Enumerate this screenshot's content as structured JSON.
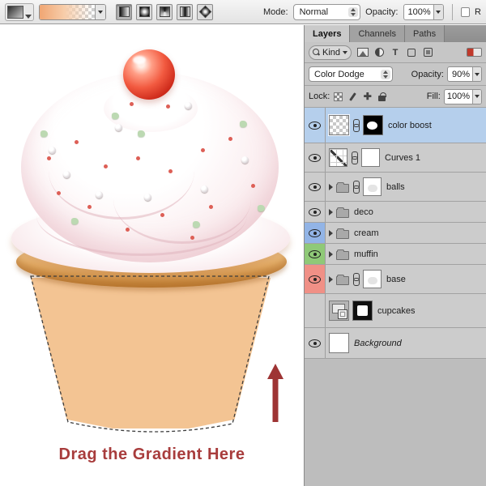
{
  "options_bar": {
    "mode_label": "Mode:",
    "mode_value": "Normal",
    "opacity_label": "Opacity:",
    "opacity_value": "100%",
    "reverse_label": "R",
    "gradient_types": [
      "linear",
      "radial",
      "angle",
      "reflected",
      "diamond"
    ]
  },
  "panel": {
    "tabs": [
      "Layers",
      "Channels",
      "Paths"
    ],
    "filter_kind_label": "Kind",
    "filter_icons": [
      "pixel-layer-filter",
      "adjustment-layer-filter",
      "type-layer-filter",
      "shape-layer-filter",
      "smart-object-filter"
    ],
    "blend_mode_value": "Color Dodge",
    "opacity_label": "Opacity:",
    "opacity_value": "90%",
    "lock_label": "Lock:",
    "lock_icons": [
      "lock-transparent-pixels",
      "lock-image-pixels",
      "lock-position",
      "lock-all"
    ],
    "fill_label": "Fill:",
    "fill_value": "100%",
    "layers": [
      {
        "name": "color boost",
        "kind": "pixel",
        "selected": true,
        "visible": true,
        "has_mask": true
      },
      {
        "name": "Curves 1",
        "kind": "adjustment",
        "visible": true,
        "has_mask": true
      },
      {
        "name": "balls",
        "kind": "group",
        "visible": true,
        "has_mask": true
      },
      {
        "name": "deco",
        "kind": "group",
        "visible": true
      },
      {
        "name": "cream",
        "kind": "group",
        "visible": true,
        "tag_color": "#92b4e6"
      },
      {
        "name": "muffin",
        "kind": "group",
        "visible": true,
        "tag_color": "#8fc977"
      },
      {
        "name": "base",
        "kind": "group",
        "visible": true,
        "has_mask": true,
        "tag_color": "#f09086"
      },
      {
        "name": "cupcakes",
        "kind": "smart-object",
        "visible": false,
        "has_mask": true
      },
      {
        "name": "Background",
        "kind": "background",
        "visible": true
      }
    ]
  },
  "canvas": {
    "caption": "Drag the Gradient Here"
  },
  "colors": {
    "selected_row": "#b5cfec",
    "tag_blue": "#92b4e6",
    "tag_green": "#8fc977",
    "tag_red": "#f09086",
    "caption_text": "#a83c3c",
    "arrow": "#9e3434"
  }
}
